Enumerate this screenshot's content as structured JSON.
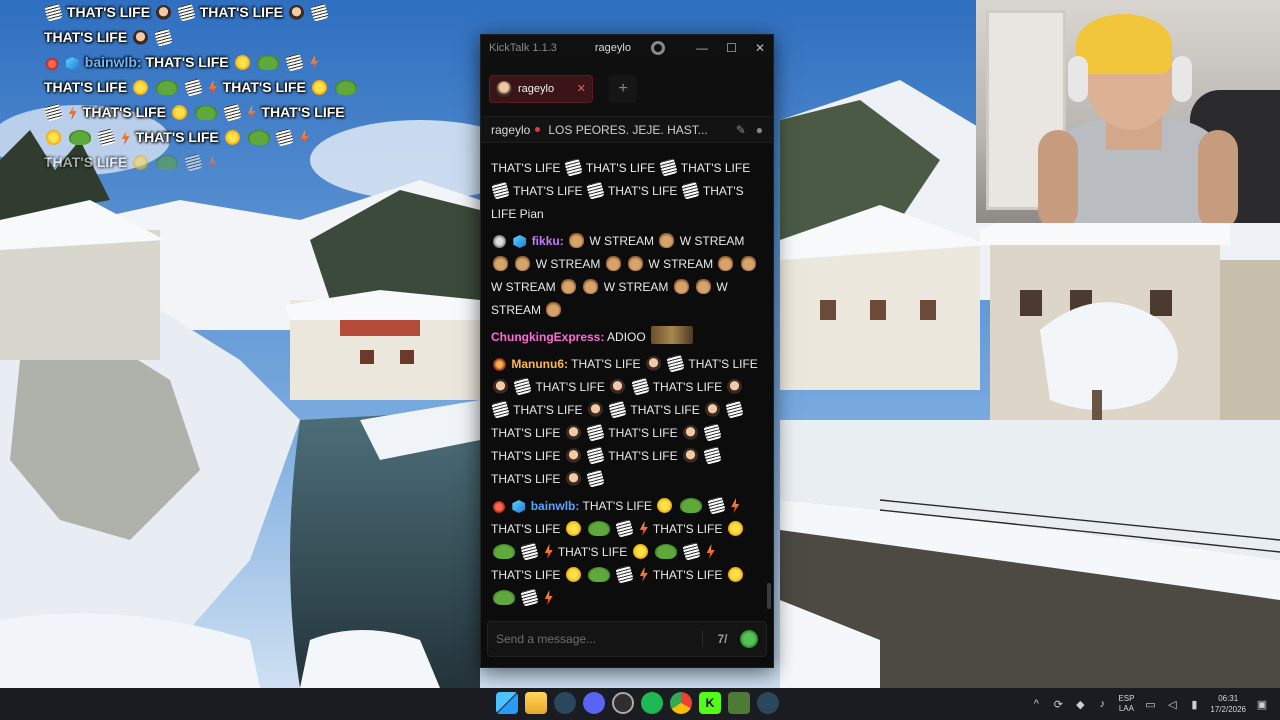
{
  "overlay_chat": {
    "line1_text": "THAT'S LIFE",
    "line1b_text": "THAT'S LIFE",
    "line2_text": "THAT'S LIFE",
    "user": "bainwlb:",
    "phrase": "THAT'S LIFE"
  },
  "window": {
    "app_title": "KickTalk 1.1.3",
    "channel": "rageylo",
    "minimize": "—",
    "maximize": "☐",
    "close": "✕"
  },
  "tabs": [
    {
      "label": "rageylo",
      "close": "✕"
    }
  ],
  "add_tab": "+",
  "pinned": {
    "user": "rageylo",
    "text": "LOS PEORES. JEJE. HAST..."
  },
  "messages": {
    "m0": {
      "p1": "THAT'S LIFE",
      "p2": "THAT'S LIFE",
      "p3": "THAT'S LIFE",
      "p4": "THAT'S LIFE",
      "p5": "THAT'S LIFE",
      "p6": "THAT'S",
      "p7": "LIFE Pian"
    },
    "m1": {
      "user": "fikku:",
      "phrase": "W STREAM",
      "w": "W",
      "stream": "STREAM"
    },
    "m2": {
      "user": "ChungkingExpress:",
      "text": "ADIOO"
    },
    "m3": {
      "user": "Manunu6:",
      "phrase": "THAT'S LIFE",
      "thats": "THAT'S",
      "life": "LIFE"
    },
    "m4": {
      "user": "bainwlb:",
      "phrase": "THAT'S LIFE"
    }
  },
  "input": {
    "placeholder": "Send a message...",
    "kick_icon": "7/"
  },
  "taskbar": {
    "lang_top": "ESP",
    "lang_bottom": "LAA",
    "time": "06:31",
    "date": "17/2/2026"
  },
  "colors": {
    "kick_green": "#53fc18",
    "tab_bg": "#3a1416",
    "window_bg": "#0c0c0c"
  }
}
